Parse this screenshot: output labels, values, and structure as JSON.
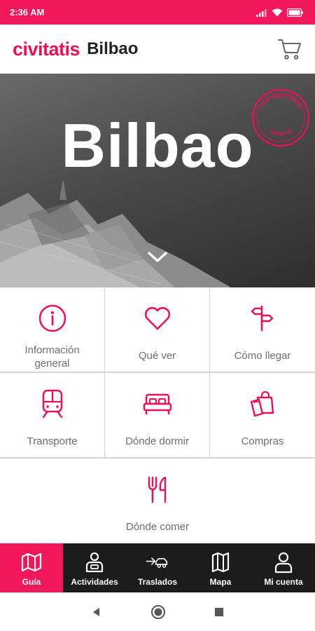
{
  "status_bar": {
    "time": "2:36 AM"
  },
  "header": {
    "brand": "civitatis",
    "city": "Bilbao"
  },
  "hero": {
    "title": "Bilbao",
    "stamp_top": "TOP DESTINOS",
    "stamp_bottom": "CIVITATIS"
  },
  "tiles": [
    {
      "label": "Información general",
      "icon": "info-icon"
    },
    {
      "label": "Qué ver",
      "icon": "heart-icon"
    },
    {
      "label": "Cómo llegar",
      "icon": "signpost-icon"
    },
    {
      "label": "Transporte",
      "icon": "train-icon"
    },
    {
      "label": "Dónde dormir",
      "icon": "bed-icon"
    },
    {
      "label": "Compras",
      "icon": "shopping-bags-icon"
    },
    {
      "label": "Dónde comer",
      "icon": "fork-knife-icon"
    }
  ],
  "bottom_nav": [
    {
      "label": "Guía",
      "icon": "map-icon",
      "active": true
    },
    {
      "label": "Actividades",
      "icon": "guide-person-icon",
      "active": false
    },
    {
      "label": "Traslados",
      "icon": "car-transfer-icon",
      "active": false
    },
    {
      "label": "Mapa",
      "icon": "folded-map-icon",
      "active": false
    },
    {
      "label": "Mi cuenta",
      "icon": "account-icon",
      "active": false
    }
  ],
  "colors": {
    "brand": "#e8105a",
    "status_bar": "#f0175a",
    "nav_bg": "#1c1c1c",
    "label_gray": "#6e6e6e"
  }
}
